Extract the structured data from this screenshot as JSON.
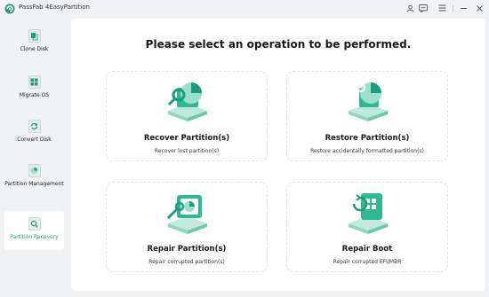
{
  "app": {
    "title": "PassFab 4EasyPartition",
    "brand_color": "#1a9d7e"
  },
  "window_controls": [
    {
      "name": "user-icon",
      "glyph": "☺"
    },
    {
      "name": "feedback-icon",
      "glyph": "✉"
    },
    {
      "name": "menu-icon",
      "glyph": "≡"
    },
    {
      "name": "minimize-icon",
      "glyph": "–"
    },
    {
      "name": "close-icon",
      "glyph": "✕"
    }
  ],
  "sidebar": {
    "items": [
      {
        "label": "Clone Disk",
        "icon": "clone-disk-icon",
        "active": false
      },
      {
        "label": "Migrate OS",
        "icon": "migrate-os-icon",
        "active": false
      },
      {
        "label": "Convert Disk",
        "icon": "convert-disk-icon",
        "active": false
      },
      {
        "label": "Partition Management",
        "icon": "partition-management-icon",
        "active": false
      },
      {
        "label": "Partition Recovery",
        "icon": "partition-recovery-icon",
        "active": true
      }
    ]
  },
  "main": {
    "heading": "Please select an operation to be performed.",
    "cards": [
      {
        "title": "Recover Partition(s)",
        "desc": "Recover lost partition(s)",
        "icon": "recover-partition-icon"
      },
      {
        "title": "Restore Partition(s)",
        "desc": "Restore accidentally formatted partition(s)",
        "icon": "restore-partition-icon"
      },
      {
        "title": "Repair Partition(s)",
        "desc": "Repair corrupted partition(s)",
        "icon": "repair-partition-icon"
      },
      {
        "title": "Repair Boot",
        "desc": "Repair corrupted EFI/MBR",
        "icon": "repair-boot-icon"
      }
    ]
  }
}
